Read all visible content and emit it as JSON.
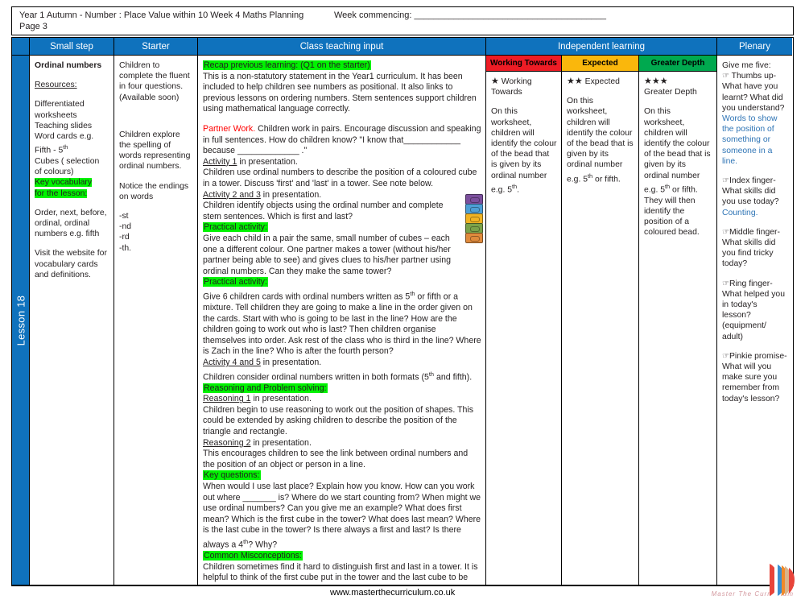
{
  "header": {
    "title_line1": "Year 1 Autumn -  Number : Place Value within 10 Week 4 Maths Planning",
    "title_line2": "Page 3",
    "week_commencing": "Week commencing: _______________________________________"
  },
  "columns": {
    "small_step": "Small step",
    "starter": "Starter",
    "class_teaching_input": "Class teaching input",
    "independent_learning": "Independent learning",
    "plenary": "Plenary"
  },
  "rag": {
    "working_towards": "Working Towards",
    "expected": "Expected",
    "greater_depth": "Greater Depth",
    "colors": {
      "working_towards": "#ee1c25",
      "expected": "#fab70c",
      "greater_depth": "#00a94f"
    }
  },
  "lesson_label": "Lesson 18",
  "accent_blue": "#0f72bd",
  "highlight_green": "#00f200",
  "small_step": {
    "heading": "Ordinal numbers",
    "resources_label": "Resources:",
    "resources": [
      "Differentiated",
      "worksheets",
      "Teaching slides",
      "Word cards e.g.",
      "Fifth - 5th",
      "Cubes ( selection",
      "of colours)"
    ],
    "key_vocab_heading_l1": "Key vocabulary",
    "key_vocab_heading_l2": "for the lesson:",
    "vocab": "Order, next, before, ordinal, ordinal numbers e.g. fifth",
    "website_note": "Visit the website for vocabulary cards and definitions."
  },
  "starter": {
    "p1": "Children to complete the fluent in four questions. (Available soon)",
    "p2": "Children explore the spelling of words representing ordinal numbers.",
    "p3": "Notice the endings on words",
    "endings": [
      "-st",
      "-nd",
      "-rd",
      "-th."
    ]
  },
  "teaching": {
    "recap_heading": "Recap previous learning: (Q1 on the starter)",
    "recap_body": "This is a non-statutory statement in the Year1 curriculum. It has been included to help children see numbers as positional. It also links to previous lessons on ordering numbers. Stem sentences support children using mathematical language correctly.",
    "partner_label": "Partner Work.",
    "partner_body": " Children work  in pairs. Encourage discussion and speaking in full sentences. How do children know?  \"I know that____________ because _____________ .\"",
    "activity1_label": "Activity 1",
    "activity1_rest": " in presentation.",
    "activity1_body": "Children use ordinal numbers to describe the position of a coloured cube in a tower. Discuss 'first' and 'last' in a tower. See note below.",
    "activity23_label": "Activity 2 and 3",
    "activity23_rest": " in presentation.",
    "activity23_body": "Children identify objects using the ordinal number and complete stem sentences. Which is first and last?",
    "practical1_heading": "Practical activity:",
    "practical1_body": "Give each child in a pair the same, small number of cubes – each one a different colour. One partner makes a tower (without his/her partner being able to see) and gives clues to his/her partner using  ordinal numbers. Can they make the same tower?",
    "practical2_heading": "Practical activity:",
    "practical2_body_a": "Give  6 children cards with ordinal numbers written as 5",
    "practical2_body_b": " or fifth or a mixture. Tell children they are going to make a line in the order given on the cards. Start with who is going to be last in the line? How are the children going to work out who is last? Then children organise themselves into order. Ask rest of the class who is third in the line? Where is Zach in the line? Who is after the fourth person?",
    "activity45_label": "Activity 4 and 5",
    "activity45_rest": " in presentation.",
    "activity45_body_a": "Children consider ordinal numbers written in both formats (5",
    "activity45_body_b": " and fifth).",
    "reasoning_heading": "Reasoning and Problem solving:",
    "reasoning1_label": "Reasoning 1",
    "reasoning1_rest": " in presentation.",
    "reasoning1_body": "Children begin to use reasoning to work out the position of shapes. This could be extended by asking children to describe the position of the triangle and rectangle.",
    "reasoning2_label": "Reasoning 2",
    "reasoning2_rest": " in presentation.",
    "reasoning2_body": "This encourages children to see the link between ordinal numbers and the position of an object or person in a line.",
    "key_questions_heading": "Key questions:",
    "key_questions_body_a": "When would I use last place? Explain how you know. How can you work out where _______ is? Where do we start counting from? When might we use ordinal numbers? Can you give me an example? What does first mean? Which is the first cube in the tower? What does last mean? Where is the last cube in the tower? Is there always a first and last? Is there always a 4",
    "key_questions_body_b": "? Why?",
    "misconceptions_heading": "Common Misconceptions:",
    "misconceptions_body": "Children sometimes find it hard to distinguish first and last in a tower. It is helpful to think of the first cube put in the tower and the last cube to be added.",
    "cube_tower_colors": [
      "#7b4f9d",
      "#4d9fd6",
      "#f0b323",
      "#7aa24a",
      "#e08a3c"
    ]
  },
  "independent": {
    "working_towards": {
      "star_count": 1,
      "label": "Working Towards",
      "body_a": "On this worksheet, children will identify the colour of the bead that is given by its ordinal number e.g. 5",
      "body_b": "."
    },
    "expected": {
      "star_count": 2,
      "label": "Expected",
      "body_a": "On this worksheet, children will identify the colour of the bead that is given by its ordinal number e.g. 5",
      "body_b": " or fifth."
    },
    "greater_depth": {
      "star_count": 3,
      "label": "Greater Depth",
      "body_a": "On this worksheet, children will identify the colour of the bead that is given by its ordinal number e.g. 5",
      "body_b": " or fifth. They will then identify the position of a coloured bead."
    }
  },
  "plenary": {
    "intro": "Give me five:",
    "items": [
      {
        "icon": "hand-icon",
        "text_black": " Thumbs up- What have you learnt? What did you understand?",
        "text_blue": "Words to show the position of something or someone in a line."
      },
      {
        "icon": "hand-icon",
        "text_black": "Index finger- What skills did you use today? ",
        "text_blue": "Counting."
      },
      {
        "icon": "hand-icon",
        "text_black": "Middle finger- What skills did you find tricky today?",
        "text_blue": ""
      },
      {
        "icon": "hand-icon",
        "text_black": "Ring finger- What helped you in today's lesson? (equipment/ adult)",
        "text_blue": ""
      },
      {
        "icon": "hand-icon",
        "text_black": "Pinkie promise- What will you make sure you remember from today's lesson?",
        "text_blue": ""
      }
    ]
  },
  "footer": {
    "url": "www.masterthecurriculum.co.uk",
    "brand": "Master The Curriculum"
  },
  "glyphs": {
    "star": "★",
    "hand": "☞",
    "ordinal_th": "th"
  }
}
